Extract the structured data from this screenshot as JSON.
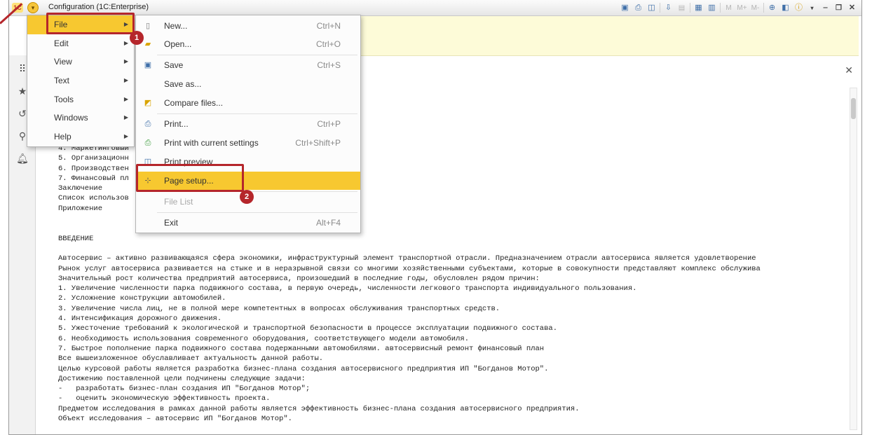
{
  "window": {
    "title": "Configuration  (1C:Enterprise)",
    "logo_text": "1C"
  },
  "toolbar": {
    "icons": [
      "save-icon",
      "print-icon",
      "print-preview-icon",
      "download-icon",
      "document-icon",
      "calculator-icon",
      "calendar-icon",
      "memory-m-icon",
      "memory-plus-icon",
      "memory-minus-icon",
      "zoom-icon",
      "panels-icon",
      "info-icon"
    ],
    "memory_labels": [
      "M",
      "M+",
      "M-"
    ]
  },
  "sidebar": {
    "icons": [
      "apps-grid-icon",
      "star-icon",
      "history-icon",
      "search-icon",
      "bell-icon"
    ]
  },
  "main_menu": {
    "items": [
      {
        "label": "File",
        "active": true
      },
      {
        "label": "Edit",
        "active": false
      },
      {
        "label": "View",
        "active": false
      },
      {
        "label": "Text",
        "active": false
      },
      {
        "label": "Tools",
        "active": false
      },
      {
        "label": "Windows",
        "active": false
      },
      {
        "label": "Help",
        "active": false
      }
    ]
  },
  "file_menu": {
    "items": [
      {
        "label": "New...",
        "shortcut": "Ctrl+N",
        "icon": "new-document-icon",
        "state": "normal"
      },
      {
        "label": "Open...",
        "shortcut": "Ctrl+O",
        "icon": "open-folder-icon",
        "state": "normal"
      },
      {
        "label": "Save",
        "shortcut": "Ctrl+S",
        "icon": "save-icon",
        "state": "normal"
      },
      {
        "label": "Save as...",
        "shortcut": "",
        "icon": "",
        "state": "normal"
      },
      {
        "label": "Compare files...",
        "shortcut": "",
        "icon": "compare-files-icon",
        "state": "normal"
      },
      {
        "label": "Print...",
        "shortcut": "Ctrl+P",
        "icon": "print-icon",
        "state": "normal"
      },
      {
        "label": "Print with current settings",
        "shortcut": "Ctrl+Shift+P",
        "icon": "print-settings-icon",
        "state": "normal"
      },
      {
        "label": "Print preview",
        "shortcut": "",
        "icon": "print-preview-icon",
        "state": "normal"
      },
      {
        "label": "Page setup...",
        "shortcut": "",
        "icon": "page-setup-icon",
        "state": "highlighted"
      },
      {
        "label": "File List",
        "shortcut": "",
        "icon": "",
        "state": "disabled"
      },
      {
        "label": "Exit",
        "shortcut": "Alt+F4",
        "icon": "",
        "state": "normal"
      }
    ]
  },
  "annotations": {
    "step1": "1",
    "step2": "2"
  },
  "document": {
    "lines": [
      "4. Маркетинговый",
      "5. Организационн",
      "6. Производствен",
      "7. Финансовый пл",
      "Заключение",
      "Список использов",
      "Приложение",
      "",
      "",
      "ВВЕДЕНИЕ",
      "",
      "Автосервис – активно развивающаяся сфера экономики, инфраструктурный элемент транспортной отрасли. Предназначением отрасли автосервиса является удовлетворение",
      "Рынок услуг автосервиса развивается на стыке и в неразрывной связи со многими хозяйственными субъектами, которые в совокупности представляют комплекс обслужива",
      "Значительный рост количества предприятий автосервиса, произошедший в последние годы, обусловлен рядом причин:",
      "1. Увеличение численности парка подвижного состава, в первую очередь, численности легкового транспорта индивидуального пользования.",
      "2. Усложнение конструкции автомобилей.",
      "3. Увеличение числа лиц, не в полной мере компетентных в вопросах обслуживания транспортных средств.",
      "4. Интенсификация дорожного движения.",
      "5. Ужесточение требований к экологической и транспортной безопасности в процессе эксплуатации подвижного состава.",
      "6. Необходимость использования современного оборудования, соответствующего модели автомобиля.",
      "7. Быстрое пополнение парка подвижного состава подержанными автомобилями. автосервисный ремонт финансовый план",
      "Все вышеизложенное обуславливает актуальность данной работы.",
      "Целью курсовой работы является разработка бизнес-плана создания автосервисного предприятия ИП \"Богданов Мотор\".",
      "Достижению поставленной цели подчинены следующие задачи:",
      "-   разработать бизнес-план создания ИП \"Богданов Мотор\";",
      "-   оценить экономическую эффективность проекта.",
      "Предметом исследования в рамках данной работы является эффективность бизнес-плана создания автосервисного предприятия.",
      "Объект исследования – автосервис ИП \"Богданов Мотор\"."
    ]
  },
  "colors": {
    "accent": "#f7c830",
    "annotation": "#b5262b",
    "banner": "#fdfbd8"
  }
}
